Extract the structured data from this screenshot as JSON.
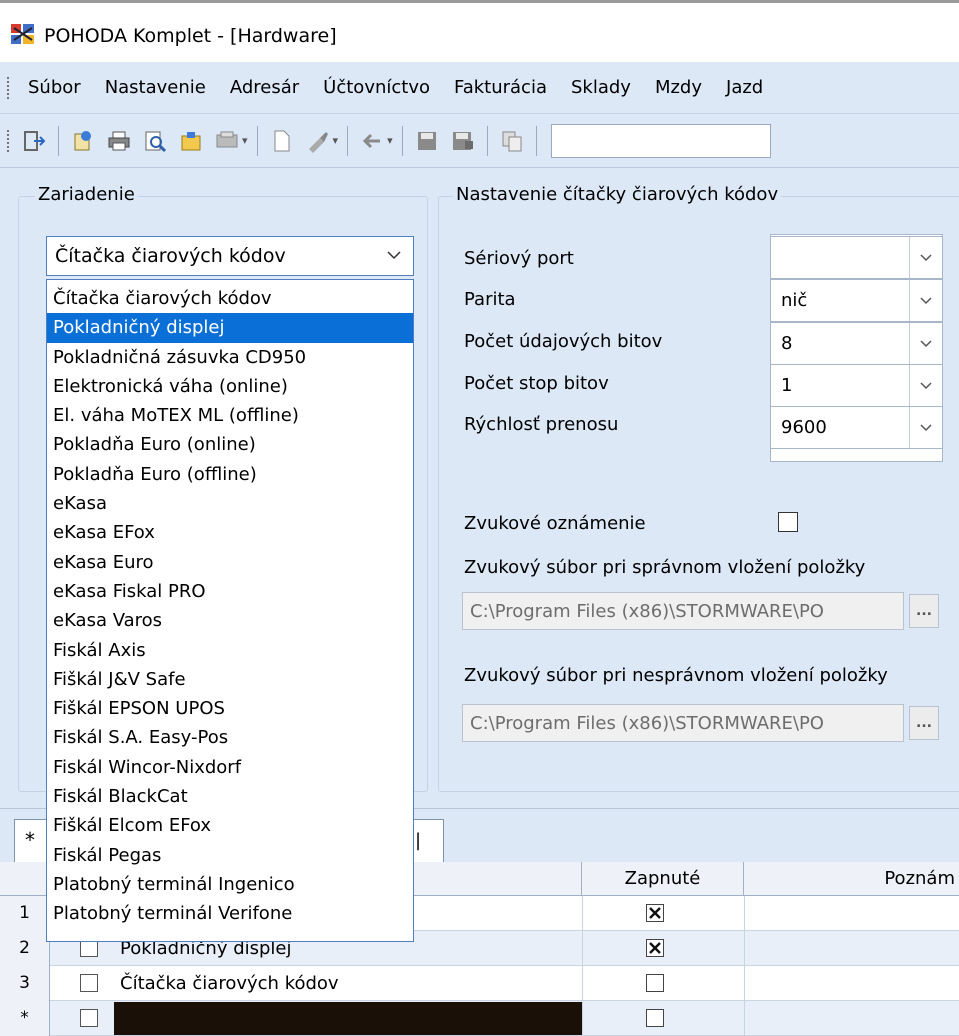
{
  "window": {
    "title": "POHODA Komplet - [Hardware]"
  },
  "menu": {
    "items": [
      "Súbor",
      "Nastavenie",
      "Adresár",
      "Účtovníctvo",
      "Fakturácia",
      "Sklady",
      "Mzdy",
      "Jazd"
    ]
  },
  "colors": {
    "panel_bg": "#dde8f6",
    "selection": "#0a6fd6",
    "border_accent": "#4f7fbf"
  },
  "device_group": {
    "legend": "Zariadenie",
    "selected_device": "Čítačka čiarových kódov",
    "options": [
      "Čítačka čiarových kódov",
      "Pokladničný displej",
      "Pokladničná zásuvka CD950",
      "Elektronická váha (online)",
      "El. váha MoTEX ML (offline)",
      "Pokladňa Euro (online)",
      "Pokladňa Euro (offline)",
      "eKasa",
      "eKasa EFox",
      "eKasa Euro",
      "eKasa Fiskal PRO",
      "eKasa Varos",
      "Fiskál Axis",
      "Fiškál J&V Safe",
      "Fiškál EPSON UPOS",
      "Fiskál S.A. Easy-Pos",
      "Fiskál Wincor-Nixdorf",
      "Fiskál BlackCat",
      "Fiškál Elcom EFox",
      "Fiskál Pegas",
      "Platobný terminál Ingenico",
      "Platobný terminál Verifone"
    ],
    "highlighted_option": "Pokladničný displej"
  },
  "settings_group": {
    "legend": "Nastavenie čítačky čiarových kódov",
    "serial_port": {
      "label": "Sériový port",
      "value": ""
    },
    "parity": {
      "label": "Parita",
      "value": "nič"
    },
    "data_bits": {
      "label": "Počet údajových bitov",
      "value": "8"
    },
    "stop_bits": {
      "label": "Počet stop bitov",
      "value": "1"
    },
    "baud_rate": {
      "label": "Rýchlosť prenosu",
      "value": "9600"
    },
    "sound_notification": {
      "label": "Zvukové oznámenie",
      "checked": false
    },
    "sound_correct": {
      "label": "Zvukový súbor pri správnom vložení položky",
      "value": "C:\\Program Files (x86)\\STORMWARE\\PO"
    },
    "sound_incorrect": {
      "label": "Zvukový súbor pri nesprávnom vložení položky",
      "value": "C:\\Program Files (x86)\\STORMWARE\\PO"
    },
    "browse_label": "..."
  },
  "tab": {
    "marker": "*"
  },
  "grid": {
    "columns": [
      "Zapnuté",
      "Poznám"
    ],
    "rows": [
      {
        "num": "1",
        "name": "",
        "enabled": true
      },
      {
        "num": "2",
        "name": "Pokladničný displej",
        "enabled": true
      },
      {
        "num": "3",
        "name": "Čítačka čiarových kódov",
        "enabled": false
      },
      {
        "num": "*",
        "name": "",
        "enabled": false
      }
    ]
  }
}
